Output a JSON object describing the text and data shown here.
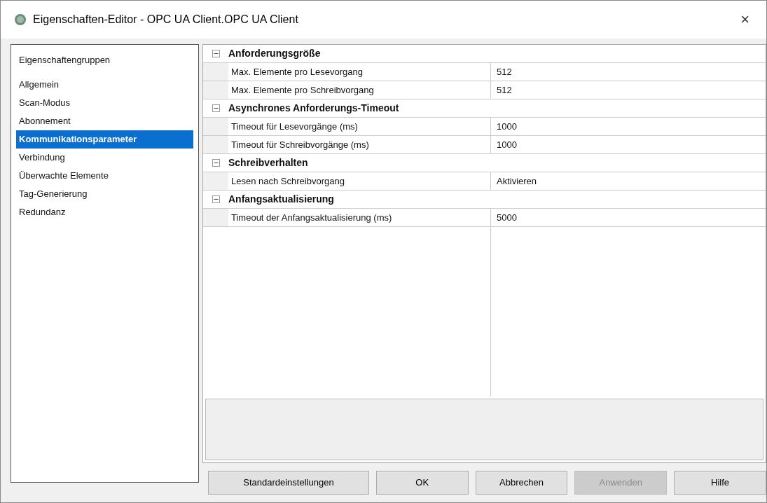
{
  "window": {
    "title": "Eigenschaften-Editor - OPC UA Client.OPC UA Client",
    "close": "×"
  },
  "sidebar": {
    "heading": "Eigenschaftengruppen",
    "items": [
      {
        "label": "Allgemein",
        "selected": false
      },
      {
        "label": "Scan-Modus",
        "selected": false
      },
      {
        "label": "Abonnement",
        "selected": false
      },
      {
        "label": "Kommunikationsparameter",
        "selected": true
      },
      {
        "label": "Verbindung",
        "selected": false
      },
      {
        "label": "Überwachte Elemente",
        "selected": false
      },
      {
        "label": "Tag-Generierung",
        "selected": false
      },
      {
        "label": "Redundanz",
        "selected": false
      }
    ]
  },
  "property_grid": {
    "groups": [
      {
        "title": "Anforderungsgröße",
        "expanded": true,
        "properties": [
          {
            "name": "Max. Elemente pro Lesevorgang",
            "value": "512"
          },
          {
            "name": "Max. Elemente pro Schreibvorgang",
            "value": "512"
          }
        ]
      },
      {
        "title": "Asynchrones Anforderungs-Timeout",
        "expanded": true,
        "properties": [
          {
            "name": "Timeout für Lesevorgänge (ms)",
            "value": "1000"
          },
          {
            "name": "Timeout für Schreibvorgänge (ms)",
            "value": "1000"
          }
        ]
      },
      {
        "title": "Schreibverhalten",
        "expanded": true,
        "properties": [
          {
            "name": "Lesen nach Schreibvorgang",
            "value": "Aktivieren"
          }
        ]
      },
      {
        "title": "Anfangsaktualisierung",
        "expanded": true,
        "properties": [
          {
            "name": "Timeout der Anfangsaktualisierung (ms)",
            "value": "5000"
          }
        ]
      }
    ]
  },
  "buttons": [
    {
      "label": "Standardeinstellungen",
      "disabled": false
    },
    {
      "label": "OK",
      "disabled": false
    },
    {
      "label": "Abbrechen",
      "disabled": false
    },
    {
      "label": "Anwenden",
      "disabled": true
    },
    {
      "label": "Hilfe",
      "disabled": false
    }
  ]
}
